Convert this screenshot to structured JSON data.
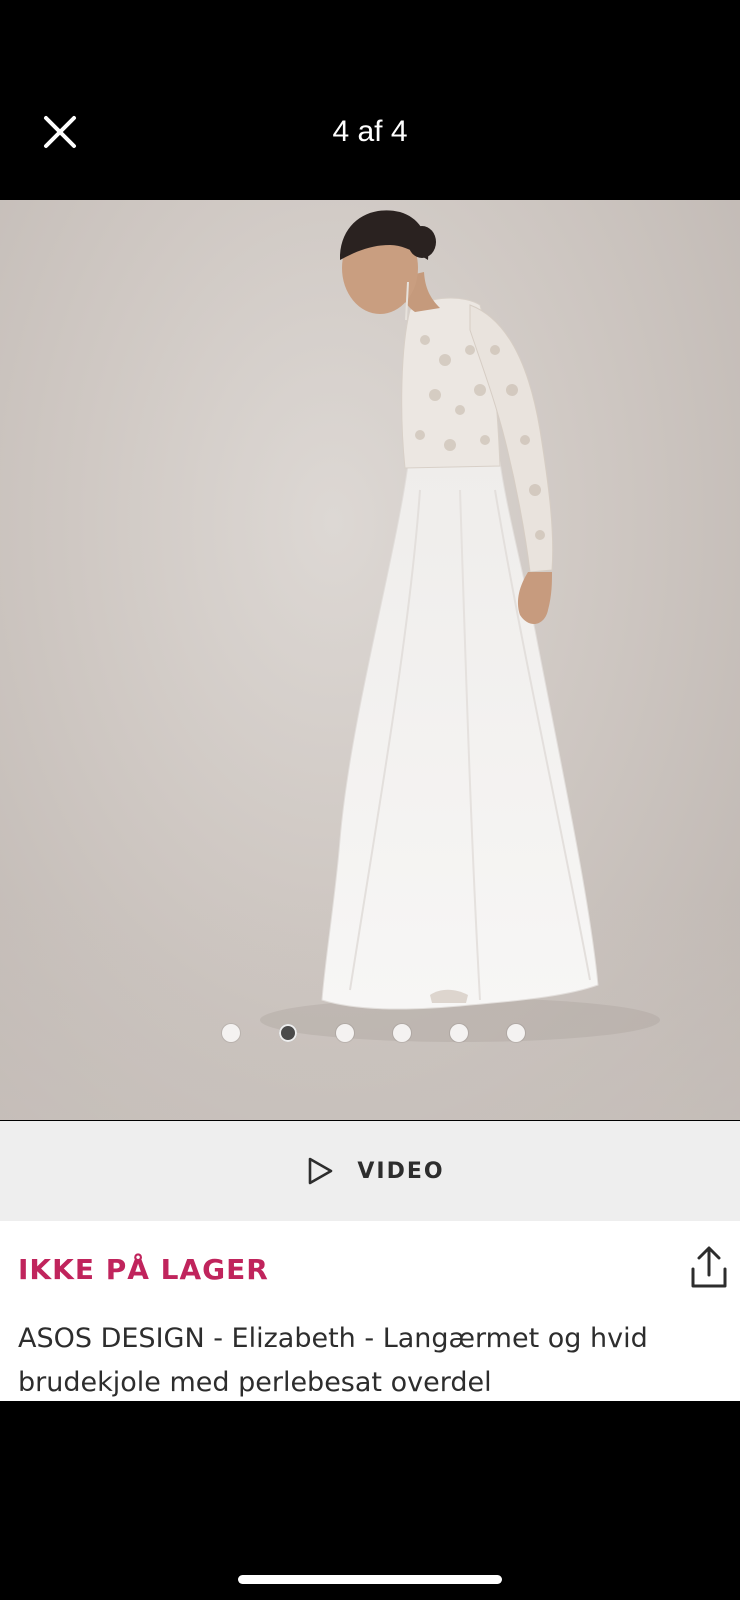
{
  "header": {
    "counter": "4 af 4",
    "close_icon": "close-icon"
  },
  "gallery": {
    "image_description_icon": "product-photo",
    "dots_total": 6,
    "active_dot_index": 1
  },
  "video": {
    "label": "VIDEO",
    "icon": "play-icon"
  },
  "product": {
    "stock_status": "IKKE PÅ LAGER",
    "title": "ASOS DESIGN - Elizabeth - Langærmet og hvid brudekjole med perlebesat overdel",
    "share_icon": "share-icon"
  },
  "colors": {
    "stock_accent": "#c0245c",
    "video_bar_bg": "#eeeeee",
    "background": "#000000"
  }
}
